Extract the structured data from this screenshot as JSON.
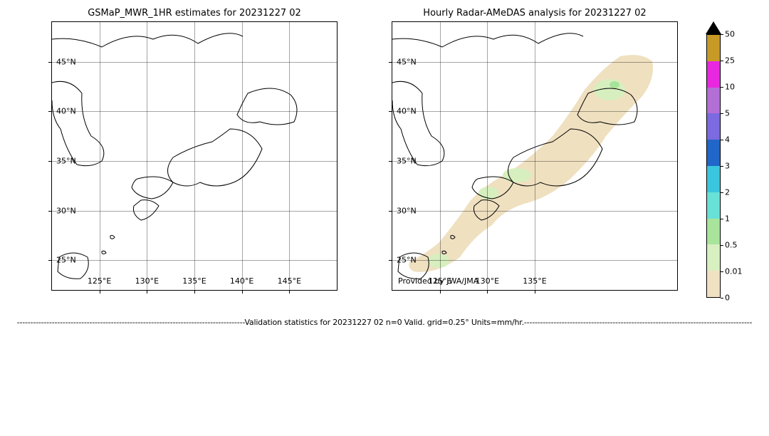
{
  "chart_data": [
    {
      "type": "heatmap",
      "title": "GSMaP_MWR_1HR estimates for 20231227 02",
      "xlabel": "",
      "ylabel": "",
      "x_ticks": [
        "125°E",
        "130°E",
        "135°E",
        "140°E",
        "145°E"
      ],
      "y_ticks": [
        "25°N",
        "30°N",
        "35°N",
        "40°N",
        "45°N"
      ],
      "xlim": [
        120,
        150
      ],
      "ylim": [
        22,
        49
      ],
      "units": "mm/hr",
      "data_note": "No precipitation field shown (empty / zero)"
    },
    {
      "type": "heatmap",
      "title": "Hourly Radar-AMeDAS analysis for 20231227 02",
      "xlabel": "",
      "ylabel": "",
      "x_ticks": [
        "125°E",
        "130°E",
        "135°E"
      ],
      "y_ticks": [
        "25°N",
        "30°N",
        "35°N",
        "40°N",
        "45°N"
      ],
      "xlim": [
        120,
        150
      ],
      "ylim": [
        22,
        49
      ],
      "units": "mm/hr",
      "credit": "Provided by JWA/JMA",
      "data_note": "Light precipitation (0.01–1 mm/hr) swath along Japanese archipelago from Ryukyu Is. through Hokkaido; scattered spots 0.5–1 mm/hr over Kyushu/Shikoku and central Hokkaido"
    }
  ],
  "colorbar": {
    "levels": [
      0,
      0.01,
      0.5,
      1,
      2,
      3,
      4,
      5,
      10,
      25,
      50
    ],
    "colors": [
      "#f0e1c2",
      "#d8efc0",
      "#a8e49b",
      "#68e1d7",
      "#3ac6de",
      "#2067c9",
      "#7b6ae0",
      "#b36fd6",
      "#e927e0",
      "#c79a25"
    ]
  },
  "footer_core": "Validation statistics for 20231227 02  n=0 Valid. grid=0.25° Units=mm/hr.",
  "titles": {
    "left": "GSMaP_MWR_1HR estimates for 20231227 02",
    "right": "Hourly Radar-AMeDAS analysis for 20231227 02"
  },
  "credit": "Provided by JWA/JMA"
}
